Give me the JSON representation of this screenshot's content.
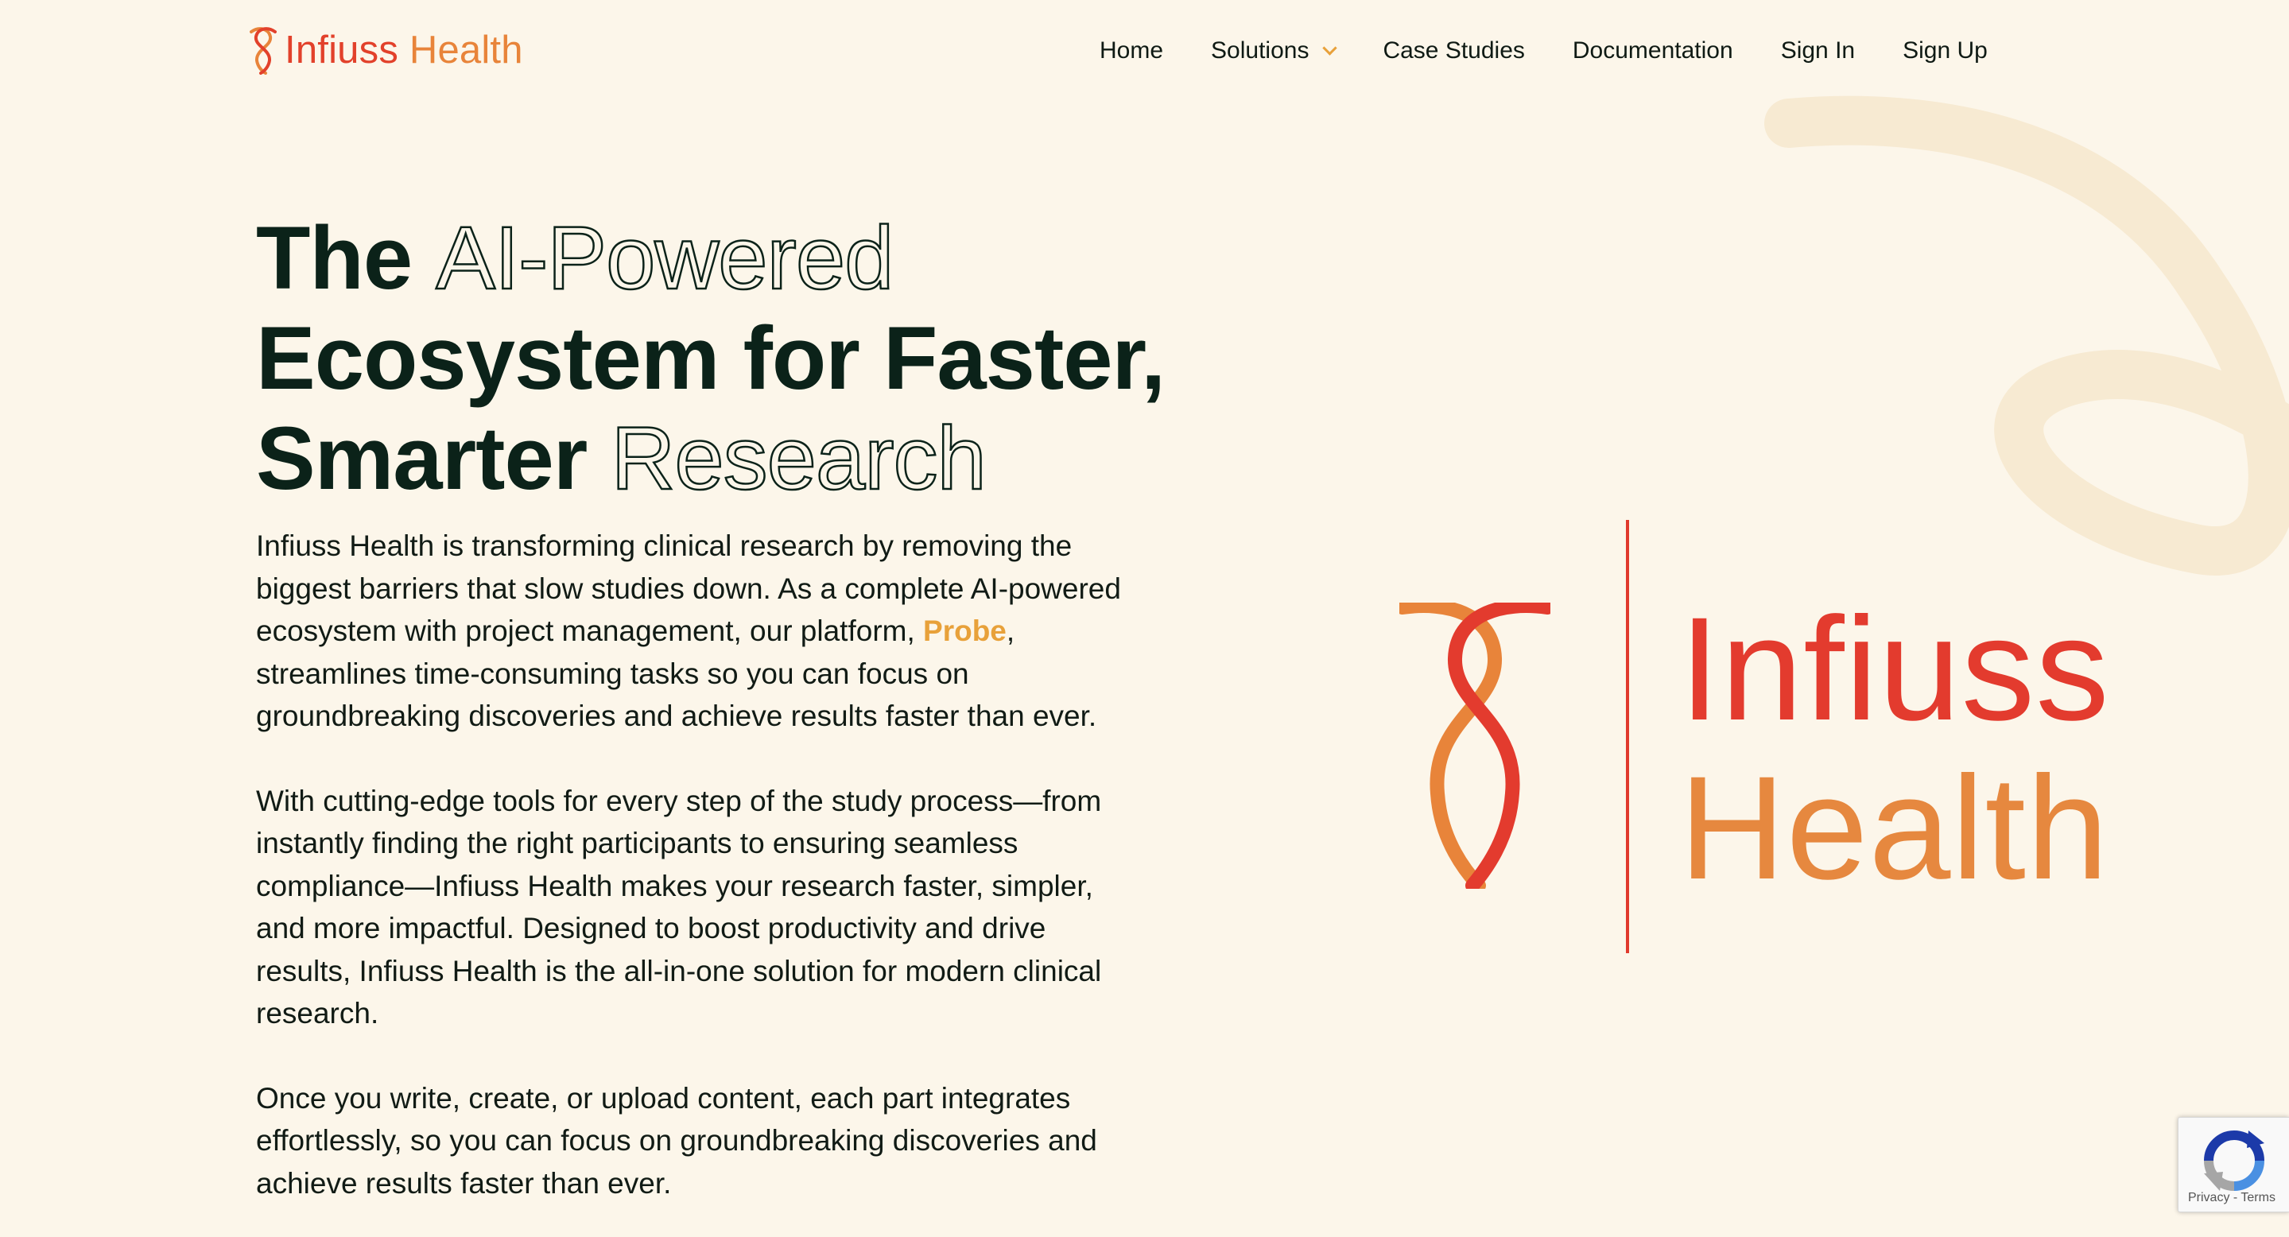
{
  "header": {
    "logo": {
      "word1": "Infiuss",
      "word2": "Health"
    },
    "nav": [
      {
        "label": "Home"
      },
      {
        "label": "Solutions",
        "has_dropdown": true
      },
      {
        "label": "Case Studies"
      },
      {
        "label": "Documentation"
      },
      {
        "label": "Sign In"
      },
      {
        "label": "Sign Up"
      }
    ]
  },
  "hero": {
    "headline": {
      "part1": "The",
      "part2_outline": "AI-Powered",
      "part3": "Ecosystem for Faster, Smarter",
      "part4_outline": "Research"
    },
    "paragraph1": {
      "before_link": "Infiuss Health is transforming clinical research by removing the biggest barriers that slow studies down. As a complete AI-powered ecosystem with project management, our platform, ",
      "link": "Probe",
      "after_link": ", streamlines time-consuming tasks so you can focus on groundbreaking discoveries and achieve results faster than ever."
    },
    "paragraph2": "With cutting-edge tools for every step of the study process—from instantly finding the right participants to ensuring seamless compliance—Infiuss Health makes your research faster, simpler, and more impactful. Designed to boost productivity and drive results, Infiuss Health is the all-in-one solution for modern clinical research.",
    "paragraph3": "Once you write, create, or upload content, each part integrates effortlessly, so you can focus on groundbreaking discoveries and achieve results faster than ever."
  },
  "brand_logo": {
    "word1": "Infiuss",
    "word2": "Health"
  },
  "recaptcha": {
    "privacy": "Privacy",
    "separator": " - ",
    "terms": "Terms"
  },
  "colors": {
    "background": "#fcf6ea",
    "swirl": "#f7ead2",
    "brand_red": "#e33b2e",
    "brand_orange": "#e6883f",
    "link_accent": "#e8a13a",
    "text_dark": "#0b2219"
  },
  "icons": {
    "logo_mark": "infiuss-helix-logo",
    "dropdown": "chevron-down-icon",
    "recaptcha": "recaptcha-icon"
  }
}
